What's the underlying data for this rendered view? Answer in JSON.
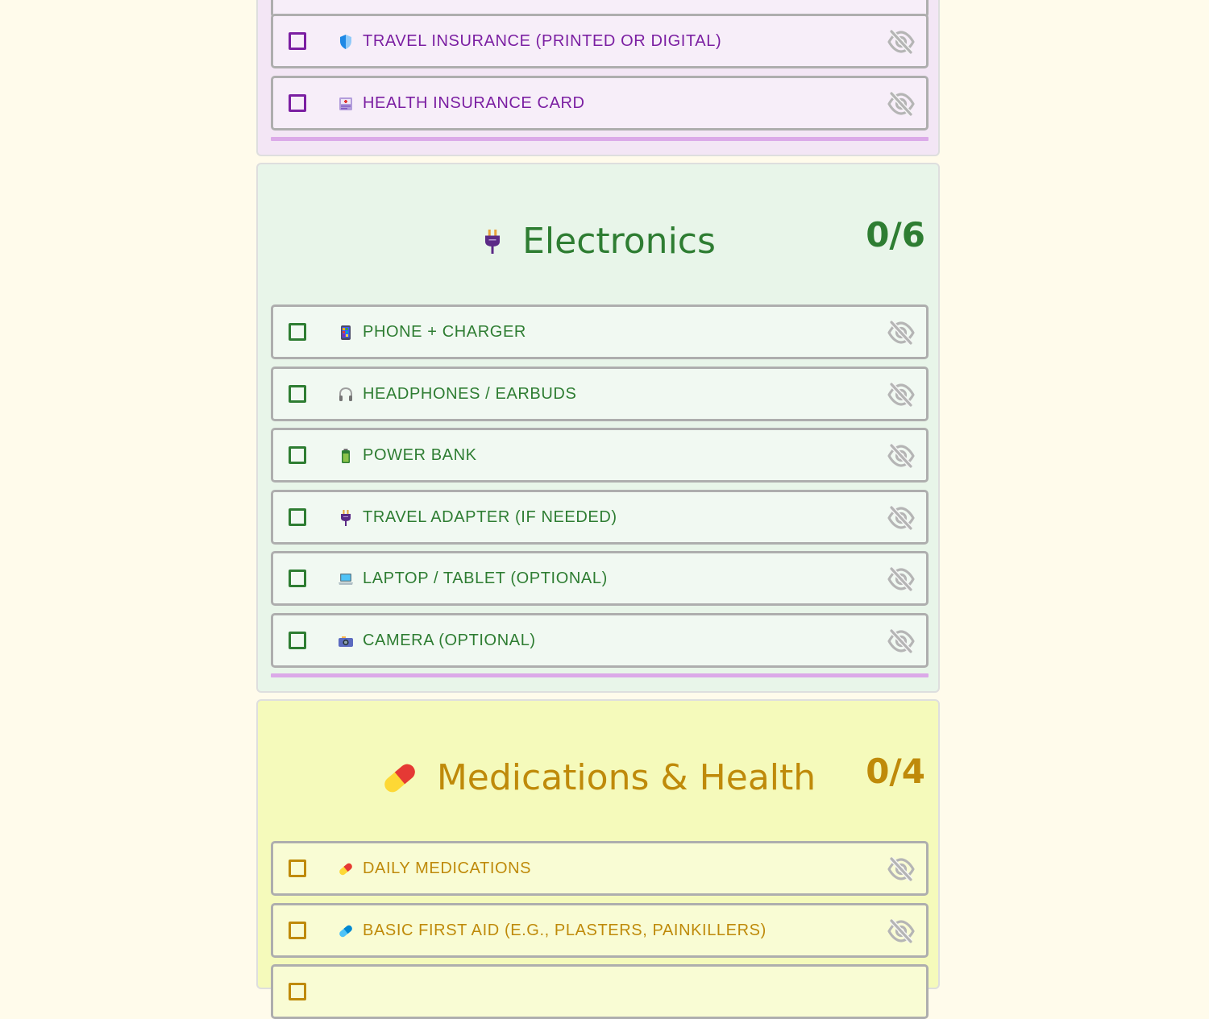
{
  "sections": {
    "documents": {
      "items": [
        {
          "label": "Travel insurance (printed or digital)",
          "icon": "shield-icon"
        },
        {
          "label": "Health insurance card",
          "icon": "id-card-icon"
        }
      ],
      "colors": {
        "background": "#f3e6f5",
        "text": "#7b1fa2"
      }
    },
    "electronics": {
      "title": "Electronics",
      "count": "0/6",
      "icon": "plug-icon",
      "items": [
        {
          "label": "Phone + charger",
          "icon": "phone-icon"
        },
        {
          "label": "Headphones / earbuds",
          "icon": "headphones-icon"
        },
        {
          "label": "Power bank",
          "icon": "battery-icon"
        },
        {
          "label": "Travel adapter (if needed)",
          "icon": "plug-icon"
        },
        {
          "label": "Laptop / tablet (optional)",
          "icon": "laptop-icon"
        },
        {
          "label": "Camera (optional)",
          "icon": "camera-icon"
        }
      ],
      "colors": {
        "background": "#e8f5e9",
        "text": "#2e7d32"
      }
    },
    "medications": {
      "title": "Medications & Health",
      "count": "0/4",
      "icon": "pill-icon",
      "items": [
        {
          "label": "Daily medications",
          "icon": "pill-icon"
        },
        {
          "label": "Basic first aid (e.g., plasters, painkillers)",
          "icon": "capsule-icon"
        }
      ],
      "colors": {
        "background": "#f5fabb",
        "text": "#bf8a0a"
      }
    }
  },
  "colors": {
    "page_background": "#fffbeb",
    "item_border": "#aeaeae",
    "divider": "#dba9e8",
    "hide_icon": "#b5b5b5"
  }
}
